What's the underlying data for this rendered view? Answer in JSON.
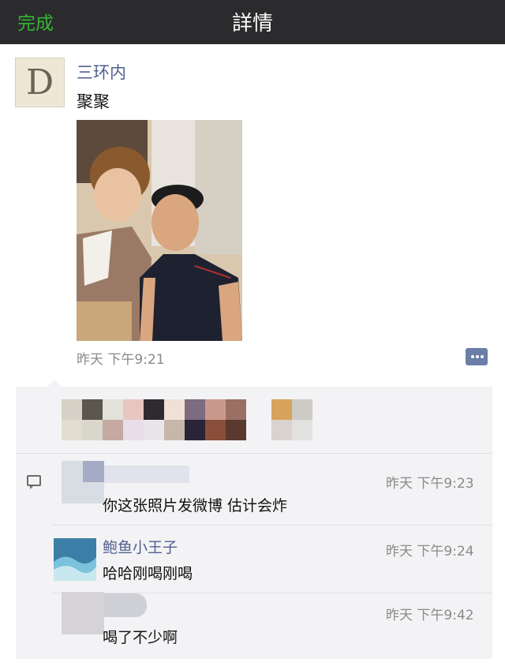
{
  "navbar": {
    "done_label": "完成",
    "title": "詳情"
  },
  "post": {
    "avatar_letter": "D",
    "author": "三环内",
    "text": "聚聚",
    "time": "昨天 下午9:21"
  },
  "comments": [
    {
      "author": "",
      "time": "昨天 下午9:23",
      "text": "你这张照片发微博 估计会炸"
    },
    {
      "author": "鲍鱼小王子",
      "time": "昨天 下午9:24",
      "text": "哈哈刚喝刚喝"
    },
    {
      "author": "",
      "time": "昨天 下午9:42",
      "text": "喝了不少啊"
    }
  ],
  "colors": {
    "navbar_bg": "#2b2b2d",
    "done_green": "#36b436",
    "name_blue": "#51608e",
    "interact_bg": "#f3f3f5"
  },
  "icons": {
    "comment_action": "comment-bubble-icon",
    "comment_section": "comment-icon"
  }
}
